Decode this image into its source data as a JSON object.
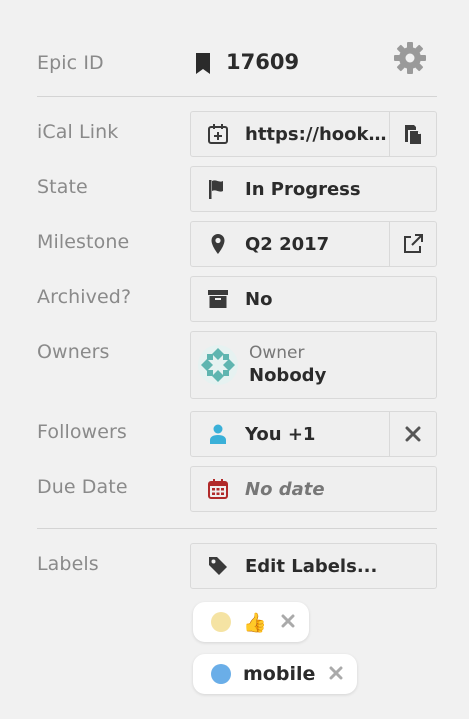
{
  "epic": {
    "label": "Epic ID",
    "id": "17609"
  },
  "ical": {
    "label": "iCal Link",
    "value": "https://hooks..."
  },
  "state": {
    "label": "State",
    "value": "In Progress"
  },
  "milestone": {
    "label": "Milestone",
    "value": "Q2 2017"
  },
  "archived": {
    "label": "Archived?",
    "value": "No"
  },
  "owners": {
    "label": "Owners",
    "role": "Owner",
    "name": "Nobody"
  },
  "followers": {
    "label": "Followers",
    "value": "You +1"
  },
  "due_date": {
    "label": "Due Date",
    "value": "No date"
  },
  "labels": {
    "label": "Labels",
    "edit_label": "Edit Labels...",
    "items": [
      {
        "text": "👍",
        "color": "#f5e3a3"
      },
      {
        "text": "mobile",
        "color": "#6aaee8"
      }
    ]
  },
  "colors": {
    "icon": "#3a3a3a",
    "muted": "#8a8a8a",
    "follower_icon": "#3ab0d8",
    "calendar_red": "#b12a2a"
  }
}
